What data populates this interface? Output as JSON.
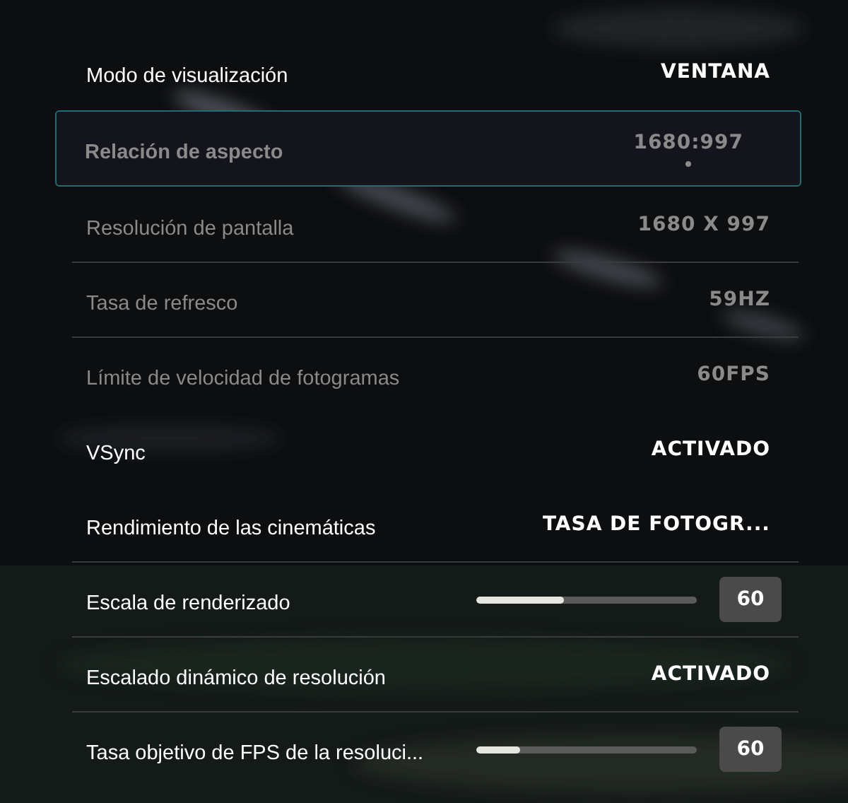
{
  "settings": [
    {
      "kind": "option",
      "label": "Modo de visualización",
      "value": "VENTANA",
      "selected": false,
      "disabled": false,
      "divider_below": false
    },
    {
      "kind": "option",
      "label": "Relación de aspecto",
      "value": "1680:997",
      "selected": true,
      "disabled": true,
      "divider_below": false
    },
    {
      "kind": "option",
      "label": "Resolución de pantalla",
      "value": "1680 X 997",
      "selected": false,
      "disabled": true,
      "divider_below": true
    },
    {
      "kind": "option",
      "label": "Tasa de refresco",
      "value": "59HZ",
      "selected": false,
      "disabled": true,
      "divider_below": true
    },
    {
      "kind": "option",
      "label": "Límite de velocidad de fotogramas",
      "value": "60FPS",
      "selected": false,
      "disabled": true,
      "divider_below": false
    },
    {
      "kind": "option",
      "label": "VSync",
      "value": "ACTIVADO",
      "selected": false,
      "disabled": false,
      "divider_below": false
    },
    {
      "kind": "option",
      "label": "Rendimiento de las cinemáticas",
      "value": "TASA DE FOTOGR...",
      "selected": false,
      "disabled": false,
      "divider_below": true
    },
    {
      "kind": "slider",
      "label": "Escala de renderizado",
      "value": "60",
      "level": 0.4,
      "selected": false,
      "disabled": false,
      "divider_below": true
    },
    {
      "kind": "option",
      "label": "Escalado dinámico de resolución",
      "value": "ACTIVADO",
      "selected": false,
      "disabled": false,
      "divider_below": true
    },
    {
      "kind": "slider",
      "label": "Tasa objetivo de FPS de la resoluci...",
      "value": "60",
      "level": 0.2,
      "selected": false,
      "disabled": false,
      "divider_below": false
    }
  ]
}
